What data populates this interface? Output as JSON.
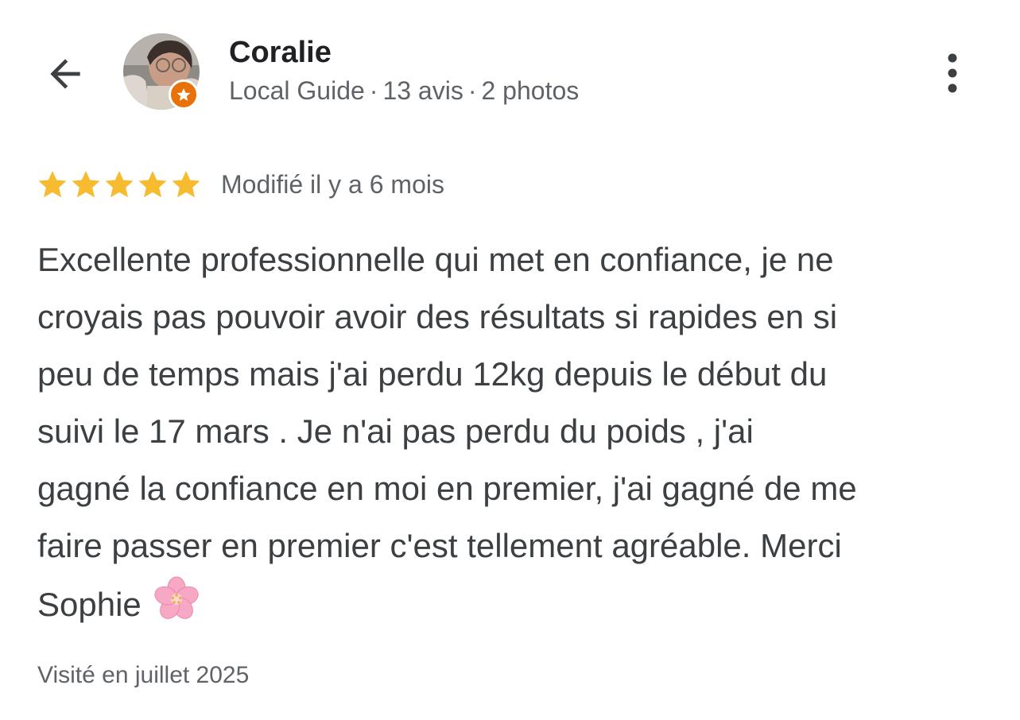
{
  "header": {
    "back_icon": "arrow-back-icon",
    "more_icon": "more-vert-icon"
  },
  "reviewer": {
    "name": "Coralie",
    "role": "Local Guide",
    "separator": "·",
    "reviews_count": "13 avis",
    "photos_count": "2 photos",
    "badge_icon": "local-guide-star-icon",
    "badge_color": "#e8710a"
  },
  "review": {
    "rating": 5,
    "max_rating": 5,
    "star_color": "#f6bb2e",
    "edited": "Modifié il y a 6 mois",
    "lines": [
      "Excellente professionnelle qui met en confiance, je ne",
      "croyais pas pouvoir avoir des résultats si rapides en si",
      "peu de temps mais j'ai perdu 12kg depuis le début du",
      "suivi le 17 mars . Je n'ai pas perdu du poids , j'ai",
      "gagné la confiance en moi en premier, j'ai gagné de me",
      "faire passer en premier c'est tellement agréable. Merci",
      "Sophie"
    ],
    "emoji_icon": "cherry-blossom-icon",
    "visit": "Visité en juillet 2025"
  }
}
